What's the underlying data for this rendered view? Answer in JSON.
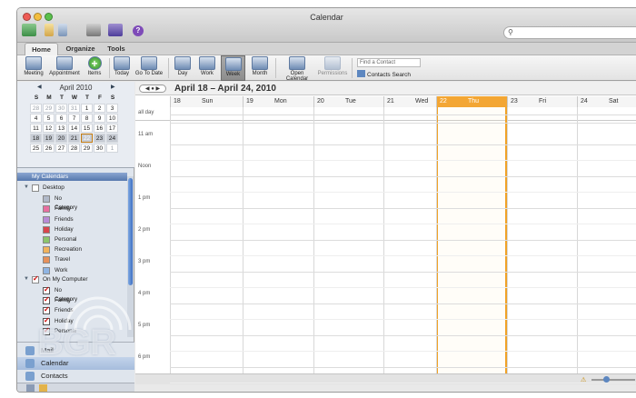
{
  "window": {
    "title": "Calendar"
  },
  "toolbar": {
    "search_placeholder": "",
    "help_glyph": "?"
  },
  "tabs": [
    "Home",
    "Organize",
    "Tools"
  ],
  "ribbon": {
    "buttons": [
      {
        "label": "Meeting",
        "sel": false,
        "dim": false
      },
      {
        "label": "Appointment",
        "sel": false,
        "dim": false
      },
      {
        "label": "Items",
        "sel": false,
        "dim": false
      },
      {
        "label": "Today",
        "sel": false,
        "dim": false
      },
      {
        "label": "Go To Date",
        "sel": false,
        "dim": false
      },
      {
        "label": "Day",
        "sel": false,
        "dim": false
      },
      {
        "label": "Work",
        "sel": false,
        "dim": false
      },
      {
        "label": "Week",
        "sel": true,
        "dim": false
      },
      {
        "label": "Month",
        "sel": false,
        "dim": false
      },
      {
        "label": "Open Calendar",
        "sel": false,
        "dim": false
      },
      {
        "label": "Permissions",
        "sel": false,
        "dim": true
      }
    ],
    "find_contact_placeholder": "Find a Contact",
    "contacts_search": "Contacts Search"
  },
  "mini_calendar": {
    "month": "April 2010",
    "weekdays": [
      "S",
      "M",
      "T",
      "W",
      "T",
      "F",
      "S"
    ],
    "weeks": [
      [
        "28",
        "29",
        "30",
        "31",
        "1",
        "2",
        "3"
      ],
      [
        "4",
        "5",
        "6",
        "7",
        "8",
        "9",
        "10"
      ],
      [
        "11",
        "12",
        "13",
        "14",
        "15",
        "16",
        "17"
      ],
      [
        "18",
        "19",
        "20",
        "21",
        "22",
        "23",
        "24"
      ],
      [
        "25",
        "26",
        "27",
        "28",
        "29",
        "30",
        "1"
      ]
    ],
    "today": "22"
  },
  "calendars": {
    "header": "My Calendars",
    "groups": [
      {
        "name": "Desktop",
        "checked": false,
        "items": [
          {
            "name": "No Category",
            "color": "#b0b8c8",
            "checked": false
          },
          {
            "name": "Family",
            "color": "#e86fa0",
            "checked": false
          },
          {
            "name": "Friends",
            "color": "#b88ad6",
            "checked": false
          },
          {
            "name": "Holiday",
            "color": "#d9464d",
            "checked": false
          },
          {
            "name": "Personal",
            "color": "#8cc56b",
            "checked": false
          },
          {
            "name": "Recreation",
            "color": "#f1b25c",
            "checked": false
          },
          {
            "name": "Travel",
            "color": "#e6905a",
            "checked": false
          },
          {
            "name": "Work",
            "color": "#8fb4e3",
            "checked": false
          }
        ]
      },
      {
        "name": "On My Computer",
        "checked": true,
        "items": [
          {
            "name": "No Category",
            "color": "#b0b8c8",
            "checked": true
          },
          {
            "name": "Family",
            "color": "#e86fa0",
            "checked": true
          },
          {
            "name": "Friends",
            "color": "#b88ad6",
            "checked": true
          },
          {
            "name": "Holiday",
            "color": "#d9464d",
            "checked": true
          },
          {
            "name": "Personal",
            "color": "#8cc56b",
            "checked": true
          }
        ]
      }
    ]
  },
  "nav": [
    {
      "label": "Mail",
      "selected": false
    },
    {
      "label": "Calendar",
      "selected": true
    },
    {
      "label": "Contacts",
      "selected": false
    }
  ],
  "view": {
    "range": "April 18 – April 24, 2010",
    "days": [
      {
        "num": "18",
        "name": "Sun"
      },
      {
        "num": "19",
        "name": "Mon"
      },
      {
        "num": "20",
        "name": "Tue"
      },
      {
        "num": "21",
        "name": "Wed"
      },
      {
        "num": "22",
        "name": "Thu",
        "today": true
      },
      {
        "num": "23",
        "name": "Fri"
      },
      {
        "num": "24",
        "name": "Sat"
      }
    ],
    "allday_label": "all day",
    "hours": [
      "11 am",
      "Noon",
      "1 pm",
      "2 pm",
      "3 pm",
      "4 pm",
      "5 pm",
      "6 pm"
    ]
  },
  "watermark": "BGR"
}
